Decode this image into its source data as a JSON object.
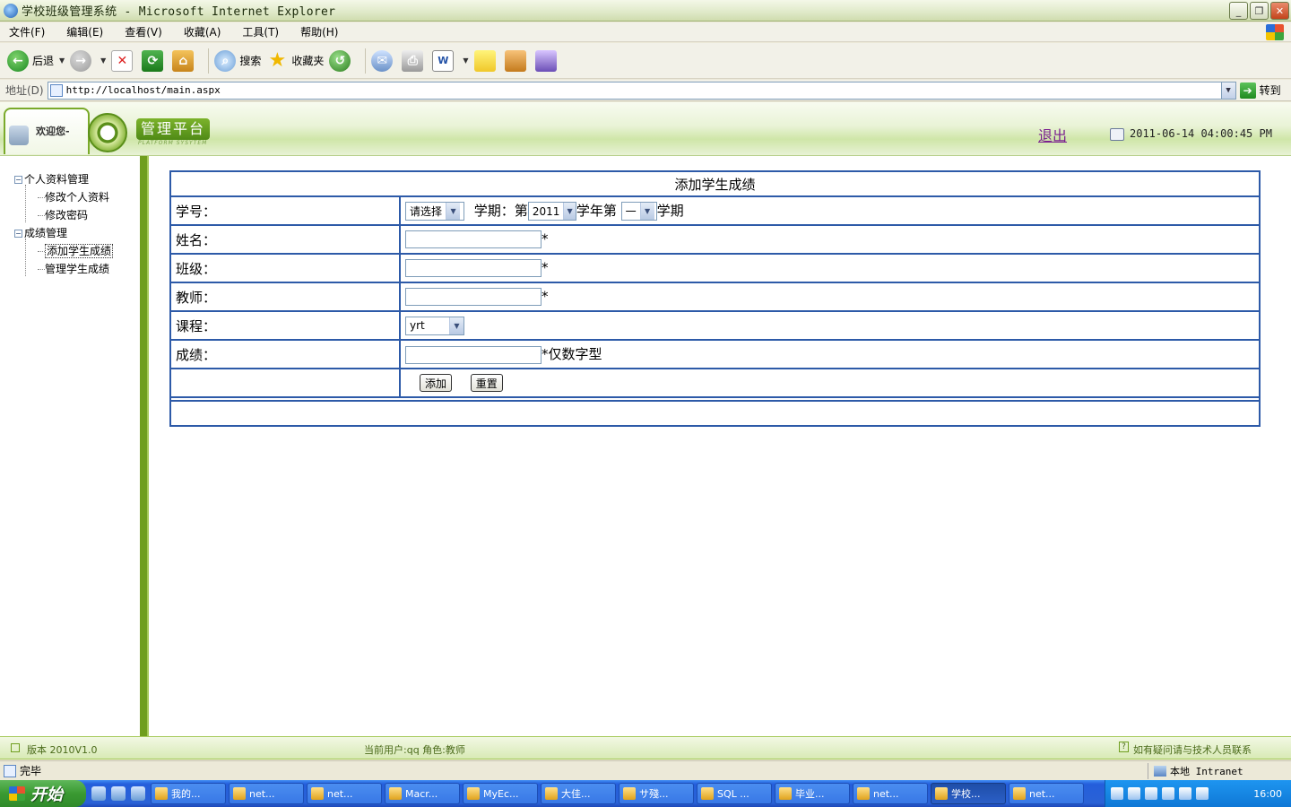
{
  "window": {
    "title": "学校班级管理系统 - Microsoft Internet Explorer",
    "minimize_icon": "minimize-icon",
    "maximize_icon": "restore-icon",
    "close_icon": "close-icon"
  },
  "menubar": {
    "items": [
      "文件(F)",
      "编辑(E)",
      "查看(V)",
      "收藏(A)",
      "工具(T)",
      "帮助(H)"
    ]
  },
  "toolbar": {
    "back_label": "后退",
    "search_label": "搜索",
    "favorites_label": "收藏夹"
  },
  "addressbar": {
    "label": "地址(D)",
    "url": "http://localhost/main.aspx",
    "go_label": "转到"
  },
  "header": {
    "welcome": "欢迎您-",
    "logo_title": "管理平台",
    "logo_subtitle": "PLATFORM SYSYTEM",
    "logout": "退出",
    "datetime": "2011-06-14 04:00:45 PM"
  },
  "sidebar": {
    "groups": [
      {
        "label": "个人资料管理",
        "items": [
          "修改个人资料",
          "修改密码"
        ]
      },
      {
        "label": "成绩管理",
        "items": [
          "添加学生成绩",
          "管理学生成绩"
        ]
      }
    ],
    "selected": "添加学生成绩"
  },
  "form": {
    "title": "添加学生成绩",
    "student_id_label": "学号：",
    "student_id_select": "请选择",
    "semester_label": "学期：",
    "semester_prefix": "第",
    "year_value": "2011",
    "year_suffix": "学年第",
    "term_value": "一",
    "term_suffix": "学期",
    "name_label": "姓名：",
    "class_label": "班级：",
    "teacher_label": "教师：",
    "course_label": "课程：",
    "course_value": "yrt",
    "score_label": "成绩：",
    "required_mark": "*",
    "score_hint": "*仅数字型",
    "add_button": "添加",
    "reset_button": "重置",
    "name_value": "",
    "class_value": "",
    "teacher_value": "",
    "score_value": ""
  },
  "footer": {
    "version": "版本 2010V1.0",
    "current_user": "当前用户:qq 角色:教师",
    "help": "如有疑问请与技术人员联系"
  },
  "statusbar": {
    "status": "完毕",
    "zone": "本地 Intranet"
  },
  "taskbar": {
    "start": "开始",
    "tasks": [
      "我的...",
      "net...",
      "net...",
      "Macr...",
      "MyEc...",
      "大佳...",
      "サ殘...",
      "SQL ...",
      "毕业...",
      "net...",
      "学校...",
      "net..."
    ],
    "active_task": "学校...",
    "clock": "16:00"
  }
}
